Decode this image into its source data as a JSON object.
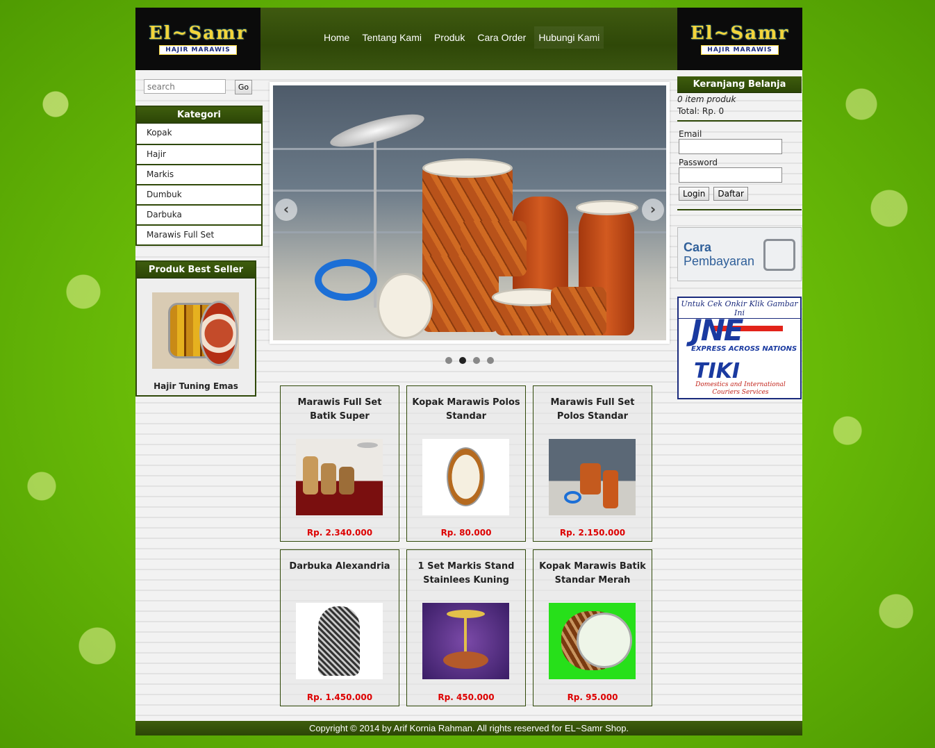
{
  "header": {
    "logo_text": "El~Samr",
    "logo_sub": "HAJIR MARAWIS",
    "nav": [
      "Home",
      "Tentang Kami",
      "Produk",
      "Cara Order",
      "Hubungi Kami"
    ]
  },
  "search": {
    "placeholder": "search",
    "go_label": "Go"
  },
  "kategori": {
    "title": "Kategori",
    "items": [
      "Kopak",
      "Hajir",
      "Markis",
      "Dumbuk",
      "Darbuka",
      "Marawis Full Set"
    ]
  },
  "best_seller": {
    "title": "Produk Best Seller",
    "name": "Hajir Tuning Emas"
  },
  "products": [
    {
      "name": "Marawis Full Set Batik Super",
      "price": "Rp. 2.340.000"
    },
    {
      "name": "Kopak Marawis Polos Standar",
      "price": "Rp. 80.000"
    },
    {
      "name": "Marawis Full Set Polos Standar",
      "price": "Rp. 2.150.000"
    },
    {
      "name": "Darbuka Alexandria",
      "price": "Rp. 1.450.000"
    },
    {
      "name": "1 Set Markis Stand Stainlees Kuning",
      "price": "Rp. 450.000"
    },
    {
      "name": "Kopak Marawis Batik Standar Merah",
      "price": "Rp. 95.000"
    }
  ],
  "cart": {
    "title": "Keranjang Belanja",
    "items": "0 item produk",
    "total": "Total: Rp. 0"
  },
  "login": {
    "email_label": "Email",
    "password_label": "Password",
    "login_button": "Login",
    "register_button": "Daftar"
  },
  "payment": {
    "line1": "Cara",
    "line2": "Pembayaran"
  },
  "courier": {
    "caption": "Untuk Cek Onkir Klik Gambar Ini",
    "jne": "JNE",
    "jne_tagline": "EXPRESS ACROSS NATIONS",
    "tiki": "TIKI",
    "tiki_tagline": "Domestics and International Couriers Services"
  },
  "footer": "Copyright © 2014 by Arif Kornia Rahman. All rights reserved for EL~Samr Shop."
}
